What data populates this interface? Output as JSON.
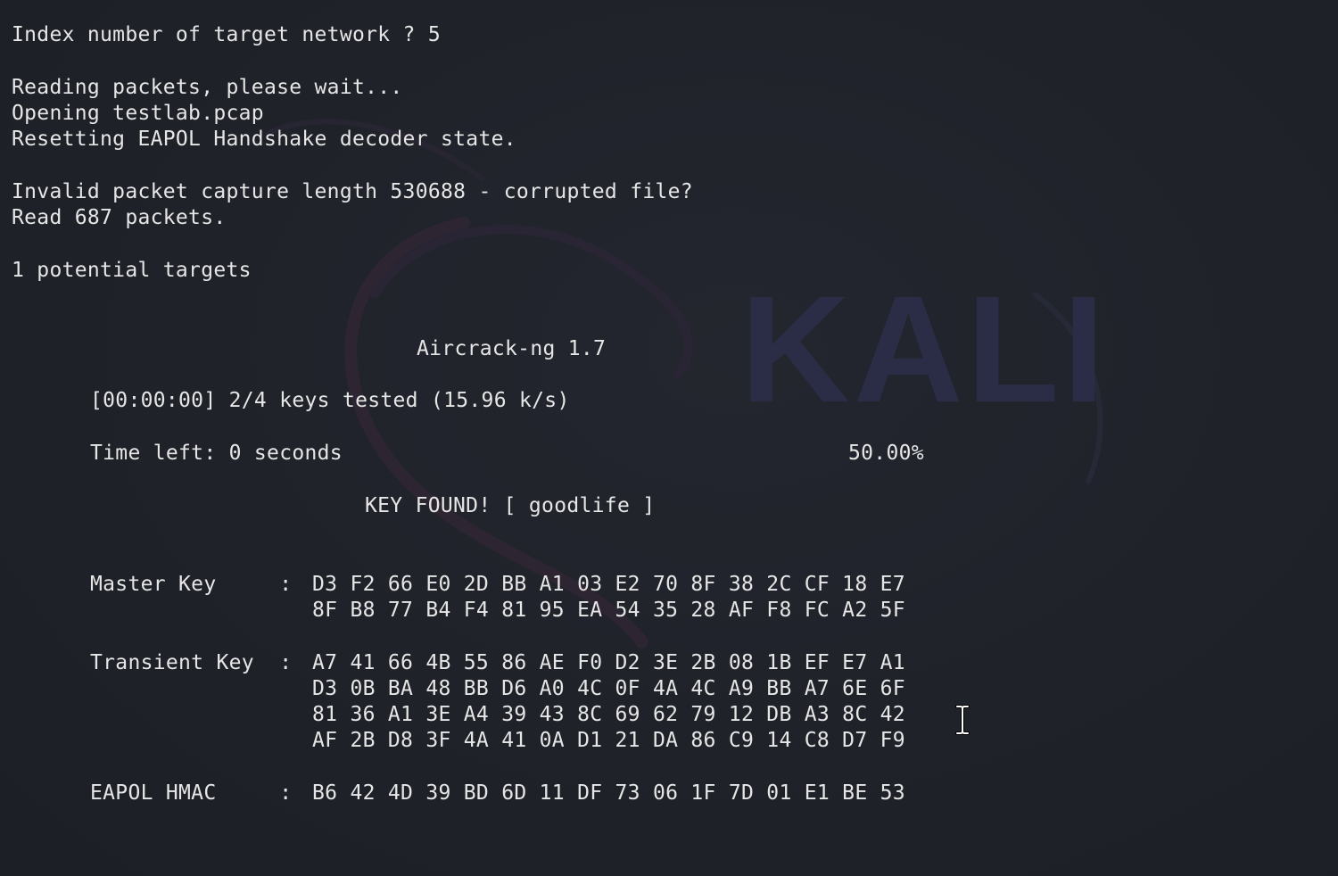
{
  "watermark": {
    "text": "KALI",
    "color": "#2a2d45"
  },
  "lines": {
    "index_prompt": "Index number of target network ? 5",
    "reading_packets": "Reading packets, please wait...",
    "opening_file": "Opening testlab.pcap",
    "resetting": "Resetting EAPOL Handshake decoder state.",
    "invalid_length": "Invalid packet capture length 530688 - corrupted file?",
    "read_packets": "Read 687 packets.",
    "potential_targets": "1 potential targets",
    "aircrack_title": "Aircrack-ng 1.7",
    "keys_tested": "[00:00:00] 2/4 keys tested (15.96 k/s)",
    "time_left": "Time left: 0 seconds",
    "percent": "50.00%",
    "key_found": "KEY FOUND! [ goodlife ]",
    "master_key_label": "Master Key     : ",
    "master_key_1": "D3 F2 66 E0 2D BB A1 03 E2 70 8F 38 2C CF 18 E7",
    "master_key_2": "8F B8 77 B4 F4 81 95 EA 54 35 28 AF F8 FC A2 5F",
    "transient_key_label": "Transient Key  : ",
    "transient_key_1": "A7 41 66 4B 55 86 AE F0 D2 3E 2B 08 1B EF E7 A1",
    "transient_key_2": "D3 0B BA 48 BB D6 A0 4C 0F 4A 4C A9 BB A7 6E 6F",
    "transient_key_3": "81 36 A1 3E A4 39 43 8C 69 62 79 12 DB A3 8C 42",
    "transient_key_4": "AF 2B D8 3F 4A 41 0A D1 21 DA 86 C9 14 C8 D7 F9",
    "eapol_hmac_label": "EAPOL HMAC     : ",
    "eapol_hmac_1": "B6 42 4D 39 BD 6D 11 DF 73 06 1F 7D 01 E1 BE 53"
  },
  "icons": {
    "cursor": "i-beam-cursor-icon",
    "dragon": "kali-dragon-logo"
  }
}
